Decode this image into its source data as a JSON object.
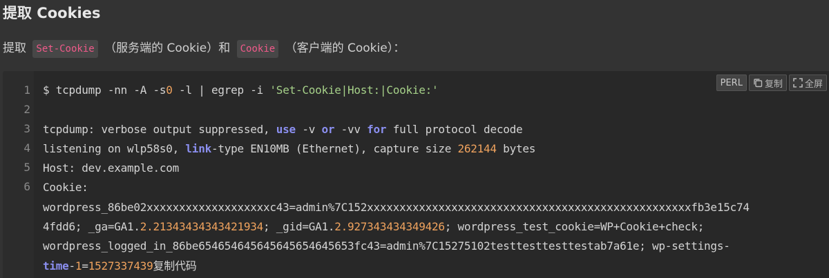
{
  "heading": "提取 Cookies",
  "intro": {
    "prefix": "提取",
    "code1": "Set-Cookie",
    "mid": "（服务端的 Cookie）和",
    "code2": "Cookie",
    "suffix": "（客户端的 Cookie）："
  },
  "toolbar": {
    "lang": "PERL",
    "copy_label": "复制",
    "fullscreen_label": "全屏",
    "copy_icon": "copy-icon",
    "fullscreen_icon": "fullscreen-icon"
  },
  "line_numbers": [
    "1",
    "2",
    "3",
    "4",
    "5",
    "6"
  ],
  "code": {
    "l1_a": "$ tcpdump -nn -A -s",
    "l1_num": "0",
    "l1_b": " -l | egrep -i ",
    "l1_str": "'Set-Cookie|Host:|Cookie:'",
    "l3_a": "tcpdump: verbose output suppressed, ",
    "l3_use": "use",
    "l3_b": " -v ",
    "l3_or": "or",
    "l3_c": " -vv ",
    "l3_for": "for",
    "l3_d": " full protocol decode",
    "l4_a": "listening on wlp58s0, ",
    "l4_link": "link",
    "l4_b": "-type EN10MB (Ethernet), capture size ",
    "l4_num": "262144",
    "l4_c": " bytes",
    "l5": "Host: dev.example.com",
    "l6": "Cookie:",
    "w1": "wordpress_86be02xxxxxxxxxxxxxxxxxxxc43=admin%7C152xxxxxxxxxxxxxxxxxxxxxxxxxxxxxxxxxxxxxxxxxxxxxxxxxxfb3e15c74",
    "w2_a": "4fdd6; _ga=GA1.",
    "w2_n1": "2.21343434343421934",
    "w2_b": "; _gid=GA1.",
    "w2_n2": "2.927343434349426",
    "w2_c": "; wordpress_test_cookie=WP+Cookie+check;",
    "w3": "wordpress_logged_in_86be654654645645645654645653fc43=admin%7C15275102testtesttesttestab7a61e; wp-settings-",
    "w4_time": "time",
    "w4_a": "-",
    "w4_one": "1",
    "w4_b": "=",
    "w4_num": "1527337439",
    "w4_c": "复制代码"
  },
  "colors": {
    "background": "#333333",
    "code_background": "#282828",
    "inline_code_text": "#f05a8a",
    "keyword": "#8b8ff0",
    "string": "#a6d189",
    "number": "#f0a35e"
  }
}
